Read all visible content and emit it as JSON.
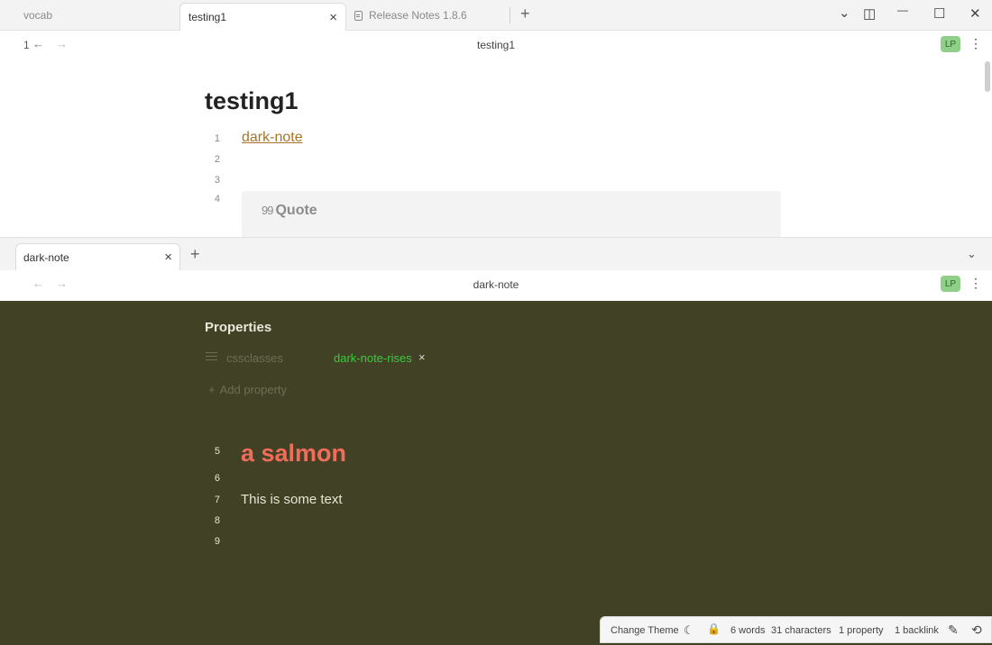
{
  "tabs": {
    "items": [
      {
        "label": "vocab"
      },
      {
        "label": "testing1"
      },
      {
        "label": "Release Notes 1.8.6"
      }
    ],
    "close_glyph": "×",
    "new_tab_glyph": "+"
  },
  "window_controls": {
    "tab_list": "⌄",
    "sidebar_toggle": "◫",
    "minimize": "—",
    "maximize": "☐",
    "close": "✕"
  },
  "pane1": {
    "nav_count": "1",
    "back_glyph": "←",
    "forward_glyph": "→",
    "view_title": "testing1",
    "mode_badge": "LP",
    "more_glyph": "⋮",
    "note_title": "testing1",
    "line_numbers": [
      "1",
      "2",
      "3",
      "4"
    ],
    "link_text": "dark-note",
    "callout_title": "Quote",
    "callout_icon": "99"
  },
  "pane2_tabs": {
    "items": [
      {
        "label": "dark-note"
      }
    ],
    "close_glyph": "×",
    "new_tab_glyph": "+",
    "tab_list": "⌄"
  },
  "pane2": {
    "back_glyph": "←",
    "forward_glyph": "→",
    "view_title": "dark-note",
    "mode_badge": "LP",
    "more_glyph": "⋮",
    "properties_heading": "Properties",
    "property": {
      "key": "cssclasses",
      "value": "dark-note-rises",
      "remove_glyph": "×"
    },
    "add_property": "Add property",
    "add_glyph": "+",
    "line_numbers": [
      "5",
      "6",
      "7",
      "8",
      "9"
    ],
    "heading": "a salmon",
    "body_text": "This is some text",
    "background_color": "#414126",
    "heading_color": "#f26c5a",
    "tag_color": "#3ec83e"
  },
  "status_bar": {
    "change_theme": "Change Theme",
    "moon_glyph": "☾",
    "lock_glyph": "🔒",
    "words": "6 words",
    "characters": "31 characters",
    "properties": "1 property",
    "backlinks": "1 backlink",
    "edit_glyph": "✎",
    "sync_glyph": "⟲"
  }
}
